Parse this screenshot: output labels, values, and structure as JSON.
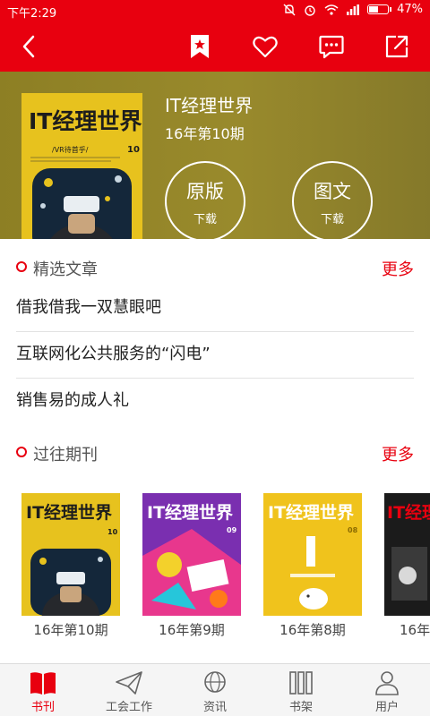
{
  "status_bar": {
    "time": "下午2:29",
    "battery": "47%",
    "battery_level": 0.47
  },
  "toolbar": {
    "back": "back-icon",
    "bookmark": "bookmark-icon",
    "favorite": "heart-icon",
    "comment": "comment-icon",
    "share": "share-icon"
  },
  "magazine": {
    "title": "IT经理世界",
    "issue": "16年第10期",
    "cover_logo": "IT经理世界",
    "cover_number": "10",
    "cover_tagline": "/VR待首乎/"
  },
  "downloads": [
    {
      "main": "原版",
      "sub": "下载"
    },
    {
      "main": "图文",
      "sub": "下载"
    }
  ],
  "featured": {
    "title": "精选文章",
    "more": "更多",
    "articles": [
      "借我借我一双慧眼吧",
      "互联网化公共服务的“闪电”",
      "销售易的成人礼"
    ]
  },
  "past": {
    "title": "过往期刊",
    "more": "更多",
    "issues": [
      {
        "label": "16年第10期",
        "logo": "IT经理世界",
        "num": "10"
      },
      {
        "label": "16年第9期",
        "logo": "IT经理世界",
        "num": "09"
      },
      {
        "label": "16年第8期",
        "logo": "IT经理世界",
        "num": "08"
      },
      {
        "label": "16年",
        "logo": "IT经理世界",
        "num": ""
      }
    ]
  },
  "nav": [
    {
      "label": "书刊",
      "icon": "book-icon",
      "active": true
    },
    {
      "label": "工会工作",
      "icon": "paper-plane-icon",
      "active": false
    },
    {
      "label": "资讯",
      "icon": "globe-icon",
      "active": false
    },
    {
      "label": "书架",
      "icon": "bookshelf-icon",
      "active": false
    },
    {
      "label": "用户",
      "icon": "user-icon",
      "active": false
    }
  ],
  "colors": {
    "accent": "#e8000f",
    "header_bg": "#948629",
    "cover_yellow": "#e7c21e"
  }
}
